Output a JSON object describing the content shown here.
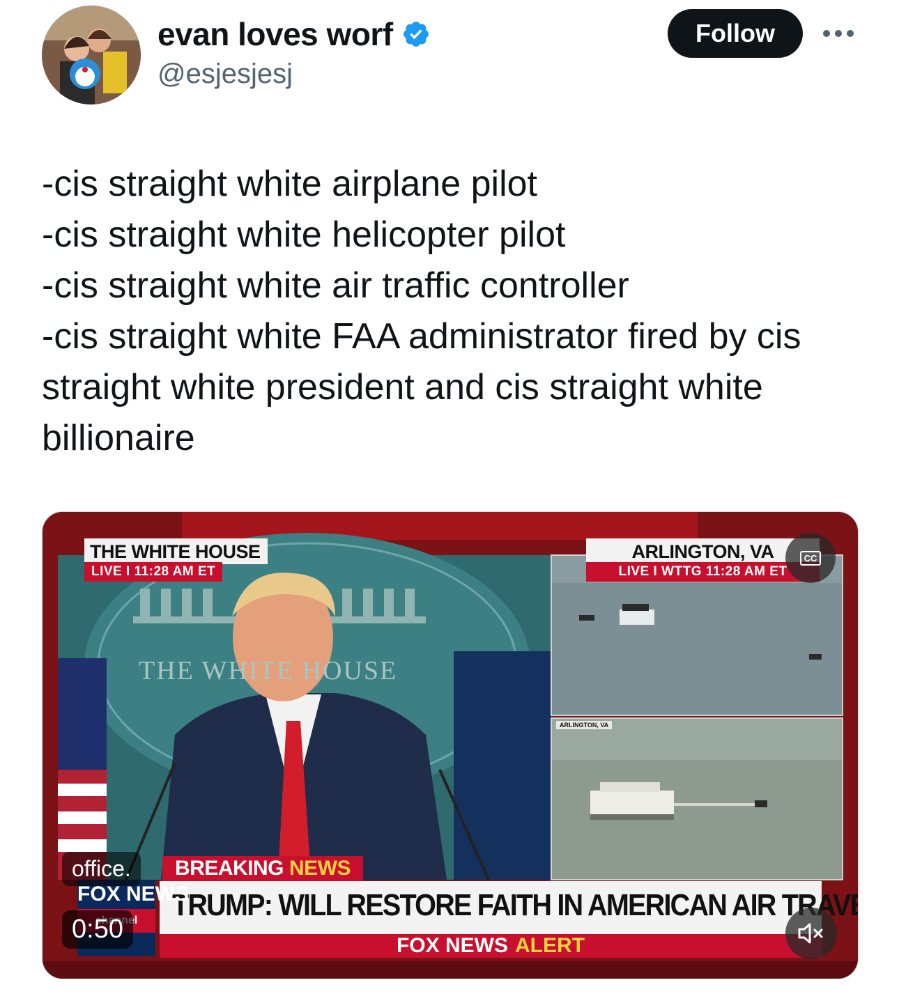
{
  "author": {
    "display_name": "evan loves worf",
    "handle": "@esjesjesj",
    "verified": true
  },
  "actions": {
    "follow_label": "Follow",
    "more_icon": "more-horizontal-icon"
  },
  "tweet": {
    "lines": [
      "-cis straight white airplane pilot",
      "-cis straight white helicopter pilot",
      "-cis straight white air traffic controller",
      "-cis straight white FAA administrator fired by cis",
      "straight white president and cis straight white",
      "billionaire"
    ]
  },
  "video": {
    "left_panel": {
      "location": "THE WHITE HOUSE",
      "live_line": "LIVE I 11:28 AM ET",
      "backdrop_text": "THE WHITE HOUSE"
    },
    "right_panel": {
      "location": "ARLINGTON, VA",
      "live_line": "LIVE I WTTG 11:28 AM ET",
      "small_label": "ARLINGTON, VA"
    },
    "breaking": "BREAKING",
    "breaking_news": "NEWS",
    "headline": "TRUMP: WILL RESTORE FAITH IN AMERICAN AIR TRAVEL",
    "alert_prefix": "FOX NEWS",
    "alert_word": "ALERT",
    "logo_text": "FOX NEWS",
    "logo_sub": "channel",
    "caption": "office.",
    "timer": "0:50",
    "cc_label": "CC",
    "colors": {
      "fox_red": "#c8102e",
      "fox_yellow": "#ffd23f",
      "verified_blue": "#1d9bf0"
    }
  }
}
